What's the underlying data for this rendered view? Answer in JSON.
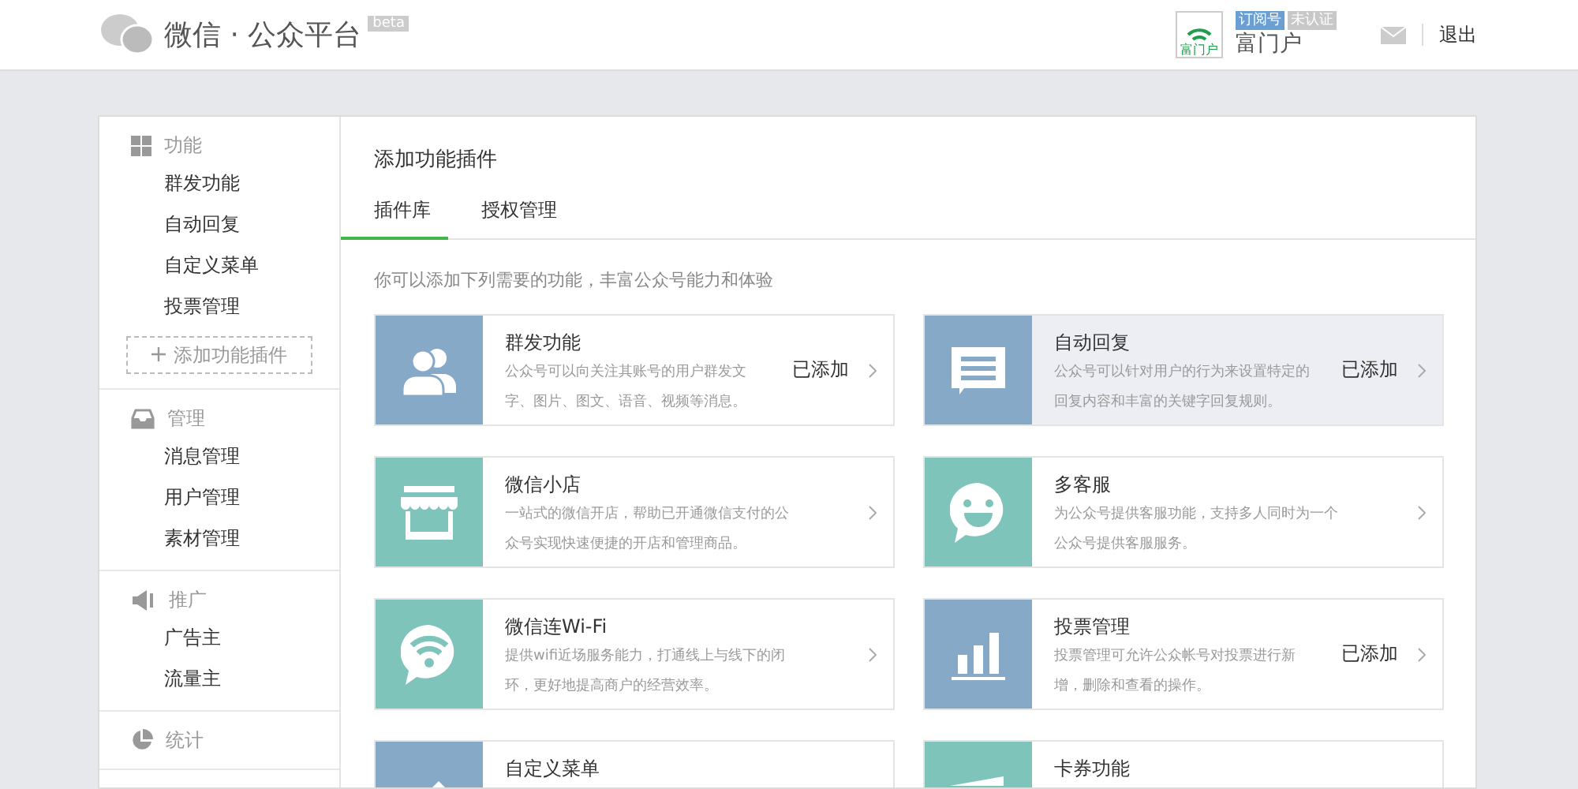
{
  "header": {
    "title": "微信 · 公众平台",
    "badge": "beta",
    "account": {
      "avatar_text": "富门户",
      "tags": [
        {
          "label": "订阅号",
          "color": "#6a9fd4"
        },
        {
          "label": "未认证",
          "color": "#c8c8c8"
        }
      ],
      "name": "富门户"
    },
    "logout": "退出"
  },
  "sidebar": {
    "sections": [
      {
        "title": "功能",
        "items": [
          "群发功能",
          "自动回复",
          "自定义菜单",
          "投票管理"
        ],
        "add_button": "添加功能插件"
      },
      {
        "title": "管理",
        "items": [
          "消息管理",
          "用户管理",
          "素材管理"
        ]
      },
      {
        "title": "推广",
        "items": [
          "广告主",
          "流量主"
        ]
      },
      {
        "title": "统计"
      }
    ]
  },
  "main": {
    "title": "添加功能插件",
    "tabs": [
      {
        "label": "插件库",
        "selected": true
      },
      {
        "label": "授权管理",
        "selected": false
      }
    ],
    "intro": "你可以添加下列需要的功能，丰富公众号能力和体验",
    "cards": [
      {
        "color": "#87a9c8",
        "title": "群发功能",
        "description": "公众号可以向关注其账号的用户群发文字、图片、图文、语音、视频等消息。",
        "status": "已添加",
        "highlighted": false
      },
      {
        "color": "#87a9c8",
        "title": "自动回复",
        "description": "公众号可以针对用户的行为来设置特定的回复内容和丰富的关键字回复规则。",
        "status": "已添加",
        "highlighted": true
      },
      {
        "color": "#7fc4bb",
        "title": "微信小店",
        "description": "一站式的微信开店，帮助已开通微信支付的公众号实现快速便捷的开店和管理商品。",
        "highlighted": false
      },
      {
        "color": "#7fc4bb",
        "title": "多客服",
        "description": "为公众号提供客服功能，支持多人同时为一个公众号提供客服服务。",
        "highlighted": false
      },
      {
        "color": "#7fc4bb",
        "title": "微信连Wi-Fi",
        "description": "提供wifi近场服务能力，打通线上与线下的闭环，更好地提高商户的经营效率。",
        "highlighted": false
      },
      {
        "color": "#87a9c8",
        "title": "投票管理",
        "description": "投票管理可允许公众帐号对投票进行新增，删除和查看的操作。",
        "status": "已添加",
        "highlighted": false
      },
      {
        "color": "#87a9c8",
        "title": "自定义菜单",
        "highlighted": false
      },
      {
        "color": "#7fc4bb",
        "title": "卡券功能",
        "highlighted": false
      }
    ]
  }
}
